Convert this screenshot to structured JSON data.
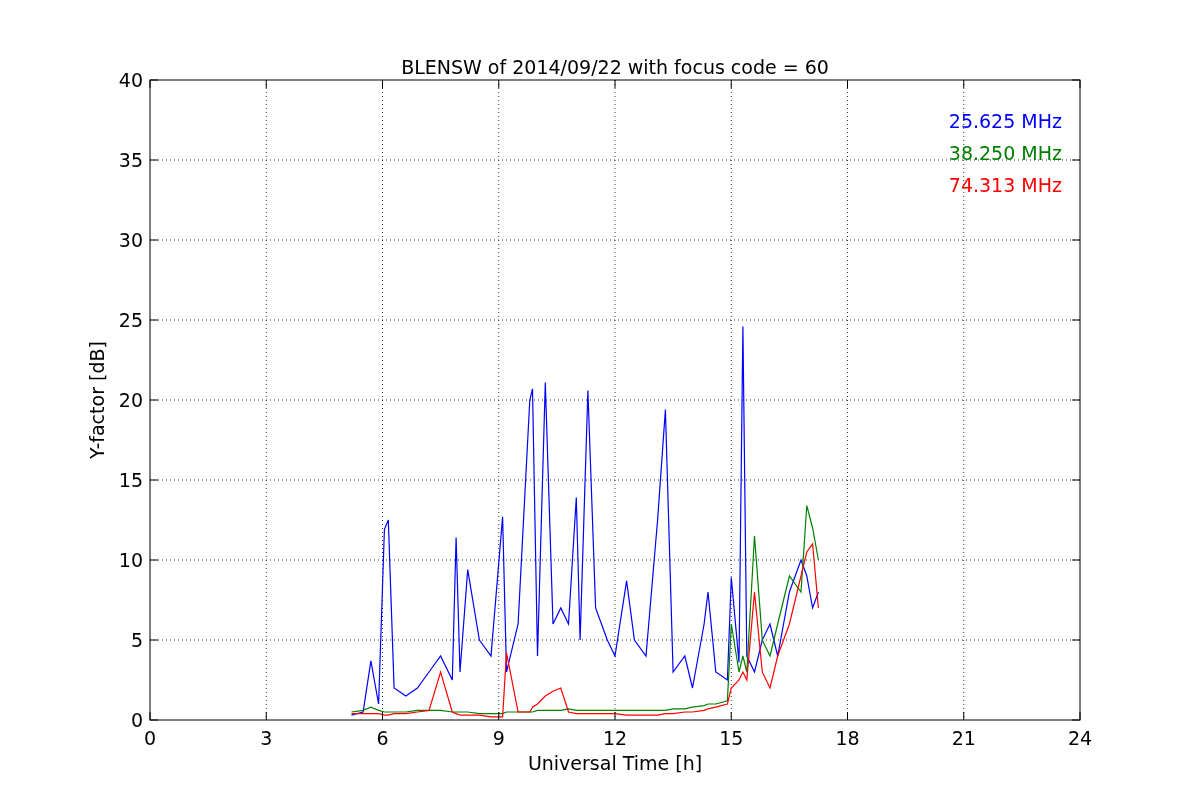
{
  "figure": {
    "chart_data": {
      "type": "line",
      "title": "BLENSW of 2014/09/22 with focus code = 60",
      "xlabel": "Universal Time [h]",
      "ylabel": "Y-factor [dB]",
      "x": [
        5.2,
        5.5,
        5.7,
        5.9,
        6.05,
        6.15,
        6.3,
        6.6,
        6.9,
        7.2,
        7.5,
        7.8,
        7.9,
        8.0,
        8.2,
        8.5,
        8.8,
        9.1,
        9.2,
        9.5,
        9.8,
        9.87,
        10.0,
        10.2,
        10.4,
        10.6,
        10.8,
        11.0,
        11.1,
        11.3,
        11.5,
        11.8,
        12.0,
        12.3,
        12.5,
        12.8,
        13.1,
        13.3,
        13.5,
        13.8,
        14.0,
        14.3,
        14.4,
        14.6,
        14.9,
        15.0,
        15.2,
        15.3,
        15.4,
        15.6,
        15.8,
        16.0,
        16.2,
        16.5,
        16.8,
        16.95,
        17.1,
        17.25
      ],
      "series": [
        {
          "name": "25.625 MHz",
          "color": "#0000ff",
          "values": [
            0.3,
            0.5,
            3.7,
            1,
            11.9,
            12.5,
            2,
            1.5,
            2,
            3,
            4,
            2.5,
            11.4,
            3,
            9.4,
            5,
            4,
            12.7,
            3,
            6,
            20,
            20.7,
            4,
            21.1,
            6,
            7,
            6,
            13.9,
            5,
            20.6,
            7,
            5,
            4,
            8.7,
            5,
            4,
            12.5,
            19.4,
            3,
            4,
            2,
            6,
            8,
            3,
            2.5,
            8.9,
            3.6,
            24.6,
            4,
            3,
            5,
            6,
            4,
            8,
            10,
            9,
            7,
            8
          ]
        },
        {
          "name": "38.250 MHz",
          "color": "#008000",
          "values": [
            0.5,
            0.6,
            0.8,
            0.6,
            0.5,
            0.5,
            0.5,
            0.5,
            0.6,
            0.6,
            0.6,
            0.5,
            0.5,
            0.5,
            0.5,
            0.4,
            0.4,
            0.4,
            0.5,
            0.5,
            0.5,
            0.5,
            0.6,
            0.6,
            0.6,
            0.6,
            0.7,
            0.6,
            0.6,
            0.6,
            0.6,
            0.6,
            0.6,
            0.6,
            0.6,
            0.6,
            0.6,
            0.6,
            0.7,
            0.7,
            0.8,
            0.9,
            1,
            1,
            1.2,
            6,
            3,
            4,
            3,
            11.5,
            5,
            4,
            6,
            9,
            8,
            13.4,
            12,
            10
          ]
        },
        {
          "name": "74.313 MHz",
          "color": "#ff0000",
          "values": [
            0.4,
            0.4,
            0.4,
            0.4,
            0.3,
            0.3,
            0.4,
            0.4,
            0.5,
            0.6,
            3,
            0.5,
            0.4,
            0.3,
            0.3,
            0.3,
            0.2,
            0.2,
            4.2,
            0.5,
            0.5,
            0.8,
            1,
            1.5,
            1.8,
            2.0,
            0.5,
            0.4,
            0.4,
            0.4,
            0.4,
            0.4,
            0.4,
            0.3,
            0.3,
            0.3,
            0.3,
            0.4,
            0.4,
            0.5,
            0.5,
            0.6,
            0.7,
            0.8,
            1,
            2,
            2.5,
            3,
            2.5,
            8,
            3,
            2,
            4,
            6,
            9,
            10.5,
            11,
            7
          ]
        }
      ],
      "xlim": [
        0,
        24
      ],
      "ylim": [
        0,
        40
      ],
      "xticks": [
        0,
        3,
        6,
        9,
        12,
        15,
        18,
        21,
        24
      ],
      "yticks": [
        0,
        5,
        10,
        15,
        20,
        25,
        30,
        35,
        40
      ],
      "grid": true
    }
  }
}
